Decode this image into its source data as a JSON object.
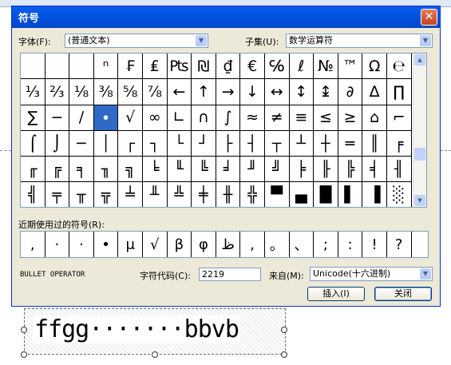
{
  "dialog": {
    "title": "符号",
    "close_glyph": "✕",
    "font_label": "字体(F):",
    "font_value": "(普通文本)",
    "subset_label": "子集(U):",
    "subset_value": "数学运算符",
    "recent_label": "近期使用过的符号(R):",
    "char_name": "BULLET OPERATOR",
    "code_label": "字符代码(C):",
    "code_value": "2219",
    "from_label": "来自(M):",
    "from_value": "Unicode(十六进制)",
    "insert_label": "插入(I)",
    "close_label": "关闭"
  },
  "grid": {
    "rows": [
      [
        "",
        "",
        "",
        "ⁿ",
        "₣",
        "₤",
        "₧",
        "₪",
        "₫",
        "€",
        "℅",
        "ℓ",
        "№",
        "™",
        "Ω",
        "℮"
      ],
      [
        "⅓",
        "⅔",
        "⅛",
        "⅜",
        "⅝",
        "⅞",
        "←",
        "↑",
        "→",
        "↓",
        "↔",
        "↕",
        "↨",
        "∂",
        "∆",
        "∏"
      ],
      [
        "∑",
        "−",
        "∕",
        "∙",
        "√",
        "∞",
        "∟",
        "∩",
        "∫",
        "≈",
        "≠",
        "≡",
        "≤",
        "≥",
        "⌂",
        "⌐"
      ],
      [
        "⌠",
        "⌡",
        "─",
        "│",
        "┌",
        "┐",
        "└",
        "┘",
        "├",
        "┤",
        "┬",
        "┴",
        "┼",
        "═",
        "║",
        "╒"
      ],
      [
        "╓",
        "╔",
        "╕",
        "╖",
        "╗",
        "╘",
        "╙",
        "╚",
        "╛",
        "╜",
        "╝",
        "╞",
        "╟",
        "╠",
        "╡",
        "╢"
      ],
      [
        "╣",
        "╤",
        "╥",
        "╦",
        "╧",
        "╨",
        "╩",
        "╪",
        "╫",
        "╬",
        "▀",
        "▄",
        "█",
        "▌",
        "▐",
        "░"
      ]
    ],
    "selected": "∙"
  },
  "recent_symbols": [
    ",",
    "·",
    "·",
    "•",
    "μ",
    "√",
    "β",
    "φ",
    "ظ",
    ",",
    "。",
    "、",
    ";",
    ":",
    "!",
    "?"
  ],
  "colors": {
    "titlebar": "#0054e3",
    "selection": "#316ac5",
    "dialog_bg": "#ece9d8"
  },
  "background_doc": {
    "text": "ffgg·······bbvb"
  }
}
